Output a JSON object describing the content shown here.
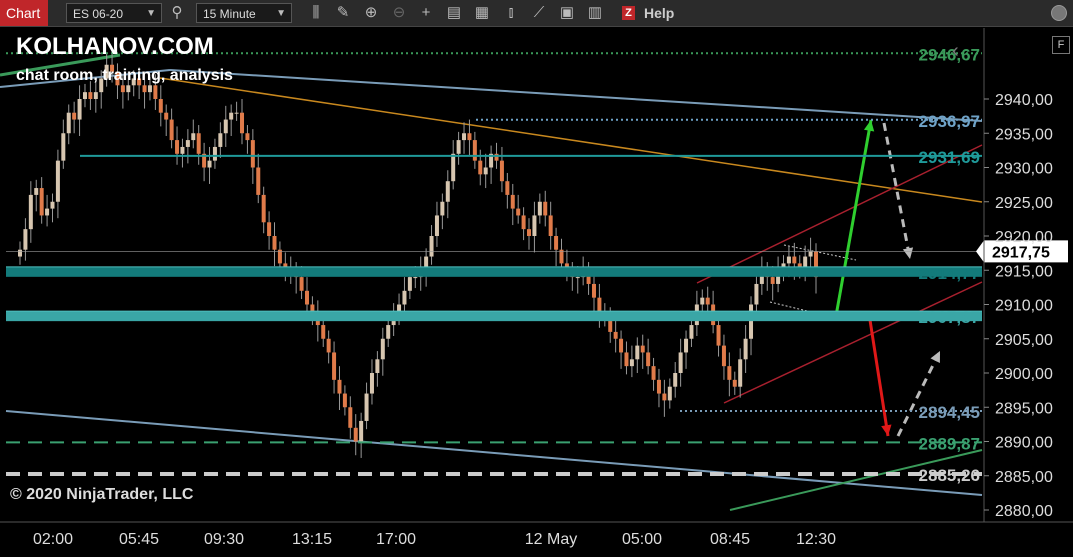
{
  "toolbar": {
    "chart_label": "Chart",
    "instrument": "ES 06-20",
    "interval": "15 Minute",
    "help_label": "Help",
    "z_label": "Z",
    "icons": [
      "search-icon",
      "bar-type-icon",
      "draw-pencil-icon",
      "zoom-in-icon",
      "zoom-out-icon",
      "crosshair-icon",
      "properties-icon",
      "data-box-icon",
      "indicators-icon",
      "strategies-icon",
      "templates-icon"
    ]
  },
  "branding": {
    "title": "KOLHANOV.COM",
    "subtitle": "chat room, training, analysis"
  },
  "copyright": "© 2020 NinjaTrader, LLC",
  "panel_button": "F",
  "colors": {
    "up": "#d7c6b0",
    "down": "#e07b4a",
    "teal": "#1f8a8a",
    "teal_band": "#127878",
    "green": "#2fcf2f",
    "red": "#e01818",
    "gray_arrow": "#bbbbbb",
    "orange_line": "#c8881e",
    "blue_line": "#7a9cb8",
    "crimson_channel": "#a8202e",
    "green_dotted": "#2f8f44"
  },
  "chart_data": {
    "type": "candlestick",
    "instrument": "ES 06-20",
    "interval": "15 Minute",
    "ylim": [
      2878,
      2952
    ],
    "y_ticks": [
      "2940,00",
      "2935,00",
      "2930,00",
      "2925,00",
      "2920,00",
      "2915,00",
      "2910,00",
      "2905,00",
      "2900,00",
      "2895,00",
      "2890,00",
      "2885,00",
      "2880,00"
    ],
    "x_ticks": [
      "02:00",
      "05:45",
      "09:30",
      "13:15",
      "17:00",
      "12 May",
      "05:00",
      "08:45",
      "12:30"
    ],
    "last_price": "2917,75",
    "levels": [
      {
        "label": "2946,67",
        "value": 2946.67,
        "color": "#3a9a5a",
        "style": "dotted"
      },
      {
        "label": "2936,97",
        "value": 2936.97,
        "color": "#6fa3c8",
        "style": "dotted"
      },
      {
        "label": "2931,69",
        "value": 2931.69,
        "color": "#1f9a9a",
        "style": "solid"
      },
      {
        "label": "2914,77",
        "value": 2914.77,
        "color": "#137b7b",
        "style": "band"
      },
      {
        "label": "2907,87",
        "value": 2908.3,
        "color": "#3aa6a6",
        "style": "band"
      },
      {
        "label": "2894,45",
        "value": 2894.45,
        "color": "#7a9cb8",
        "style": "dotted"
      },
      {
        "label": "2889,87",
        "value": 2889.87,
        "color": "#3aa070",
        "style": "dashed"
      },
      {
        "label": "2885,26",
        "value": 2885.26,
        "color": "#cccccc",
        "style": "dashed"
      }
    ],
    "candles_close": [
      2918,
      2921,
      2926,
      2927,
      2923,
      2924,
      2925,
      2931,
      2935,
      2938,
      2937,
      2940,
      2941,
      2940,
      2941,
      2943,
      2945,
      2944,
      2942,
      2941,
      2942,
      2943,
      2942,
      2941,
      2942,
      2940,
      2938,
      2937,
      2934,
      2932,
      2933,
      2934,
      2935,
      2932,
      2930,
      2931,
      2933,
      2935,
      2937,
      2938,
      2938,
      2935,
      2934,
      2930,
      2926,
      2922,
      2920,
      2918,
      2916,
      2915,
      2915,
      2914,
      2912,
      2910,
      2909,
      2907,
      2905,
      2903,
      2899,
      2897,
      2895,
      2892,
      2890,
      2893,
      2897,
      2900,
      2902,
      2905,
      2907,
      2909,
      2910,
      2912,
      2914,
      2914,
      2915,
      2917,
      2920,
      2923,
      2925,
      2928,
      2932,
      2934,
      2935,
      2934,
      2931,
      2929,
      2930,
      2932,
      2931,
      2928,
      2926,
      2924,
      2923,
      2921,
      2920,
      2923,
      2925,
      2923,
      2920,
      2918,
      2916,
      2915,
      2914,
      2914,
      2915,
      2913,
      2911,
      2909,
      2908,
      2906,
      2905,
      2903,
      2901,
      2902,
      2904,
      2903,
      2901,
      2899,
      2897,
      2896,
      2898,
      2900,
      2903,
      2905,
      2907,
      2910,
      2911,
      2910,
      2907,
      2904,
      2901,
      2899,
      2898,
      2902,
      2905,
      2910,
      2913,
      2915,
      2914,
      2913,
      2915,
      2916,
      2917,
      2916,
      2915,
      2917,
      2917.75,
      2914
    ]
  }
}
